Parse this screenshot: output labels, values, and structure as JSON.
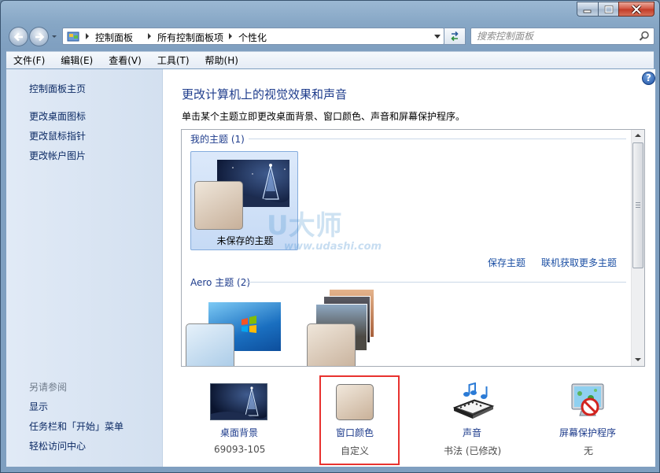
{
  "window": {
    "buttons": {
      "minimize": "minimize-icon",
      "maximize": "maximize-icon",
      "close": "close-icon"
    }
  },
  "address": {
    "breadcrumbs": [
      "控制面板",
      "所有控制面板项",
      "个性化"
    ]
  },
  "search": {
    "placeholder": "搜索控制面板"
  },
  "menu": [
    "文件(F)",
    "编辑(E)",
    "查看(V)",
    "工具(T)",
    "帮助(H)"
  ],
  "left_pane": {
    "links": [
      "控制面板主页",
      "更改桌面图标",
      "更改鼠标指针",
      "更改帐户图片"
    ],
    "see_also_title": "另请参阅",
    "see_also": [
      "显示",
      "任务栏和「开始」菜单",
      "轻松访问中心"
    ]
  },
  "main": {
    "help": "?",
    "title": "更改计算机上的视觉效果和声音",
    "description": "单击某个主题立即更改桌面背景、窗口颜色、声音和屏幕保护程序。",
    "my_themes": {
      "header": "我的主题 (1)",
      "tile_label": "未保存的主题"
    },
    "links": {
      "save": "保存主题",
      "online": "联机获取更多主题"
    },
    "aero_themes": {
      "header": "Aero 主题 (2)"
    }
  },
  "controls": [
    {
      "label": "桌面背景",
      "value": "69093-105",
      "icon": "desktop-background-icon"
    },
    {
      "label": "窗口颜色",
      "value": "自定义",
      "icon": "window-color-icon"
    },
    {
      "label": "声音",
      "value": "书法 (已修改)",
      "icon": "sound-icon"
    },
    {
      "label": "屏幕保护程序",
      "value": "无",
      "icon": "screensaver-icon"
    }
  ],
  "watermark": {
    "brand": "U大师",
    "url": "www.udashi.com"
  },
  "colors": {
    "highlight": "#e8322f",
    "link": "#1e3c8c",
    "accent_blue": "#1a4ea3"
  }
}
